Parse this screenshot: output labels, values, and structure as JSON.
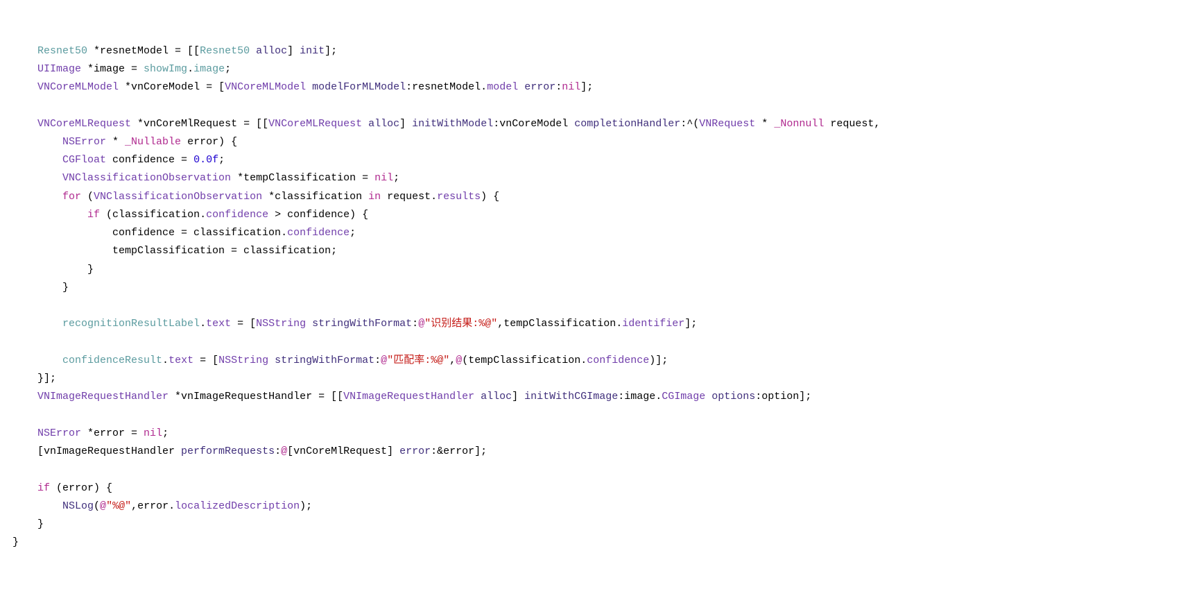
{
  "t": {
    "s1a": "    ",
    "s1b": "Resnet50",
    "s1c": " *resnetModel = [[",
    "s1d": "Resnet50",
    "s1e": " ",
    "s1f": "alloc",
    "s1g": "] ",
    "s1h": "init",
    "s1i": "];",
    "s2a": "    ",
    "s2b": "UIImage",
    "s2c": " *image = ",
    "s2d": "showImg",
    "s2e": ".",
    "s2f": "image",
    "s2g": ";",
    "s3a": "    ",
    "s3b": "VNCoreMLModel",
    "s3c": " *vnCoreModel = [",
    "s3d": "VNCoreMLModel",
    "s3e": " ",
    "s3f": "modelForMLModel",
    "s3g": ":resnetModel.",
    "s3h": "model",
    "s3i": " ",
    "s3j": "error",
    "s3k": ":",
    "s3l": "nil",
    "s3m": "];",
    "s4a": "    ",
    "s5a": "    ",
    "s5b": "VNCoreMLRequest",
    "s5c": " *vnCoreMlRequest = [[",
    "s5d": "VNCoreMLRequest",
    "s5e": " ",
    "s5f": "alloc",
    "s5g": "] ",
    "s5h": "initWithModel",
    "s5i": ":vnCoreModel ",
    "s5j": "completionHandler",
    "s5k": ":^(",
    "s5l": "VNRequest",
    "s5m": " * ",
    "s5n": "_Nonnull",
    "s5o": " request,",
    "s6a": "        ",
    "s6b": "NSError",
    "s6c": " * ",
    "s6d": "_Nullable",
    "s6e": " error) {",
    "s7a": "        ",
    "s7b": "CGFloat",
    "s7c": " confidence = ",
    "s7d": "0.0f",
    "s7e": ";",
    "s8a": "        ",
    "s8b": "VNClassificationObservation",
    "s8c": " *tempClassification = ",
    "s8d": "nil",
    "s8e": ";",
    "s9a": "        ",
    "s9b": "for",
    "s9c": " (",
    "s9d": "VNClassificationObservation",
    "s9e": " *classification ",
    "s9f": "in",
    "s9g": " request.",
    "s9h": "results",
    "s9i": ") {",
    "s10a": "            ",
    "s10b": "if",
    "s10c": " (classification.",
    "s10d": "confidence",
    "s10e": " > confidence) {",
    "s11a": "                confidence = classification.",
    "s11b": "confidence",
    "s11c": ";",
    "s12a": "                tempClassification = classification;",
    "s13a": "            }",
    "s14a": "        }",
    "s15a": "        ",
    "s16a": "        ",
    "s16b": "recognitionResultLabel",
    "s16c": ".",
    "s16d": "text",
    "s16e": " = [",
    "s16f": "NSString",
    "s16g": " ",
    "s16h": "stringWithFormat",
    "s16i": ":",
    "s16j": "@",
    "s16k": "\"识别结果:%@\"",
    "s16l": ",tempClassification.",
    "s16m": "identifier",
    "s16n": "];",
    "s17a": "        ",
    "s18a": "        ",
    "s18b": "confidenceResult",
    "s18c": ".",
    "s18d": "text",
    "s18e": " = [",
    "s18f": "NSString",
    "s18g": " ",
    "s18h": "stringWithFormat",
    "s18i": ":",
    "s18j": "@",
    "s18k": "\"匹配率:%@\"",
    "s18l": ",",
    "s18m": "@",
    "s18n": "(tempClassification.",
    "s18o": "confidence",
    "s18p": ")];",
    "s19a": "    }];",
    "s20a": "    ",
    "s20b": "VNImageRequestHandler",
    "s20c": " *vnImageRequestHandler = [[",
    "s20d": "VNImageRequestHandler",
    "s20e": " ",
    "s20f": "alloc",
    "s20g": "] ",
    "s20h": "initWithCGImage",
    "s20i": ":image.",
    "s20j": "CGImage",
    "s20k": " ",
    "s20l": "options",
    "s20m": ":option];",
    "s21a": "    ",
    "s22a": "    ",
    "s22b": "NSError",
    "s22c": " *error = ",
    "s22d": "nil",
    "s22e": ";",
    "s23a": "    [vnImageRequestHandler ",
    "s23b": "performRequests",
    "s23c": ":",
    "s23d": "@",
    "s23e": "[vnCoreMlRequest] ",
    "s23f": "error",
    "s23g": ":&error];",
    "s24a": "    ",
    "s25a": "    ",
    "s25b": "if",
    "s25c": " (error) {",
    "s26a": "        ",
    "s26b": "NSLog",
    "s26c": "(",
    "s26d": "@",
    "s26e": "\"%@\"",
    "s26f": ",error.",
    "s26g": "localizedDescription",
    "s26h": ");",
    "s27a": "    }",
    "s28a": "}"
  }
}
